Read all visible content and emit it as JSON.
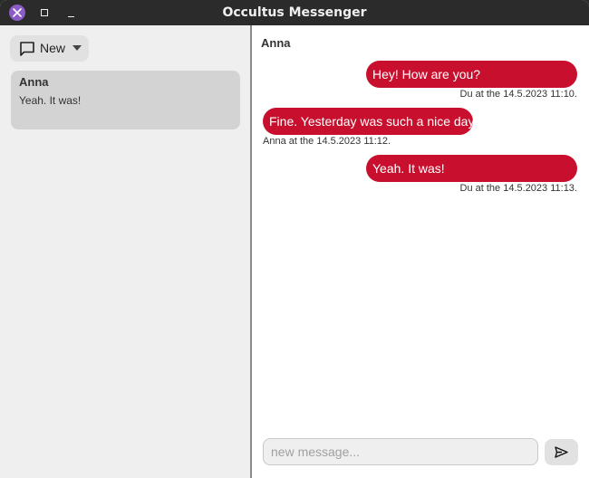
{
  "window": {
    "title": "Occultus Messenger"
  },
  "sidebar": {
    "new_button": {
      "label": "New",
      "icon": "chat-bubble-icon"
    },
    "conversations": [
      {
        "name": "Anna",
        "preview": "Yeah. It was!",
        "selected": true
      }
    ]
  },
  "chat": {
    "title": "Anna",
    "messages": [
      {
        "text": "Hey! How are you?",
        "meta": "Du at the 14.5.2023 11:10.",
        "outgoing": true
      },
      {
        "text": "Fine. Yesterday was such a nice day.",
        "meta": "Anna at the 14.5.2023 11:12.",
        "outgoing": false
      },
      {
        "text": "Yeah. It was!",
        "meta": "Du at the 14.5.2023 11:13.",
        "outgoing": true
      }
    ],
    "input": {
      "placeholder": "new message...",
      "value": ""
    },
    "send_icon": "send-icon"
  },
  "colors": {
    "bubble": "#c8102e",
    "titlebar": "#2b2b2b",
    "close_button": "#8b5cc6",
    "sidebar_bg": "#efefef",
    "selected_item": "#d3d3d3"
  }
}
